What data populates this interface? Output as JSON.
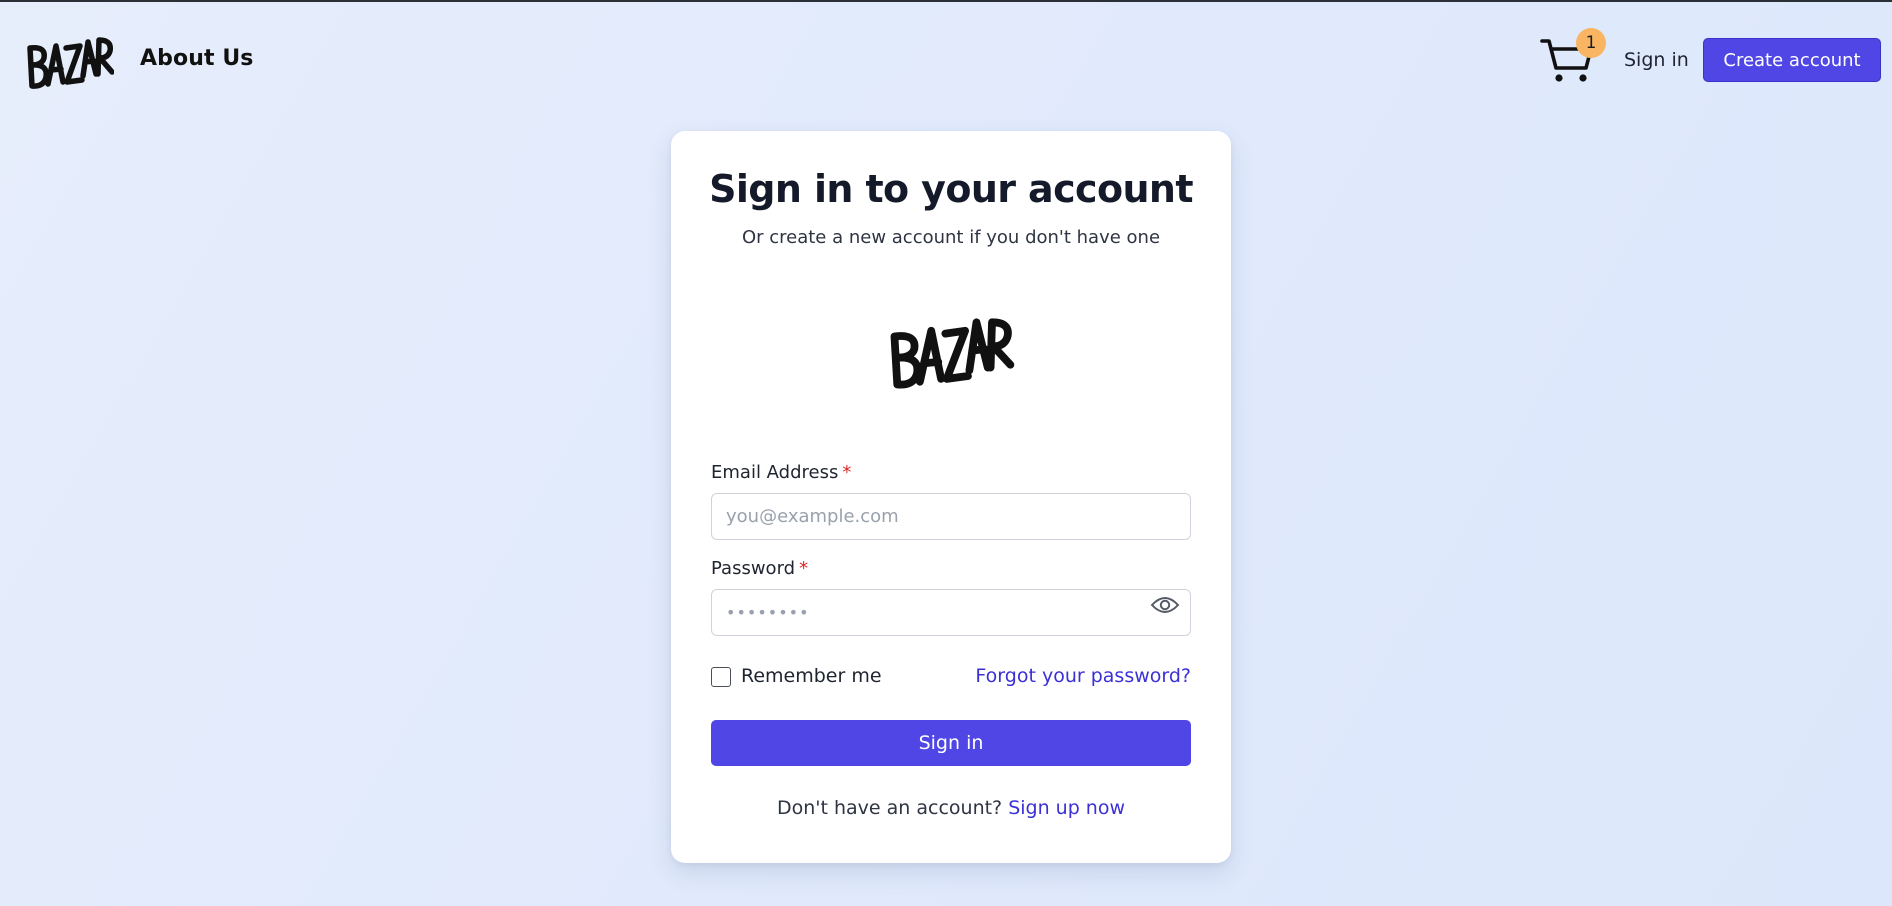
{
  "header": {
    "logo_text": "BAZAR",
    "about_label": "About Us",
    "cart_count": "1",
    "signin_label": "Sign in",
    "create_account_label": "Create account"
  },
  "card": {
    "title": "Sign in to your account",
    "subtitle": "Or create a new account if you don't have one",
    "logo_text": "BAZAR",
    "email_label": "Email Address",
    "email_placeholder": "you@example.com",
    "required_mark": "*",
    "password_label": "Password",
    "password_placeholder": "••••••••",
    "remember_label": "Remember me",
    "forgot_label": "Forgot your password?",
    "signin_button": "Sign in",
    "no_account_text": "Don't have an account?",
    "signup_label": "Sign up now"
  },
  "colors": {
    "accent": "#4f46e5",
    "link": "#3b30d6",
    "badge": "#f9b562",
    "required": "#e02424"
  }
}
